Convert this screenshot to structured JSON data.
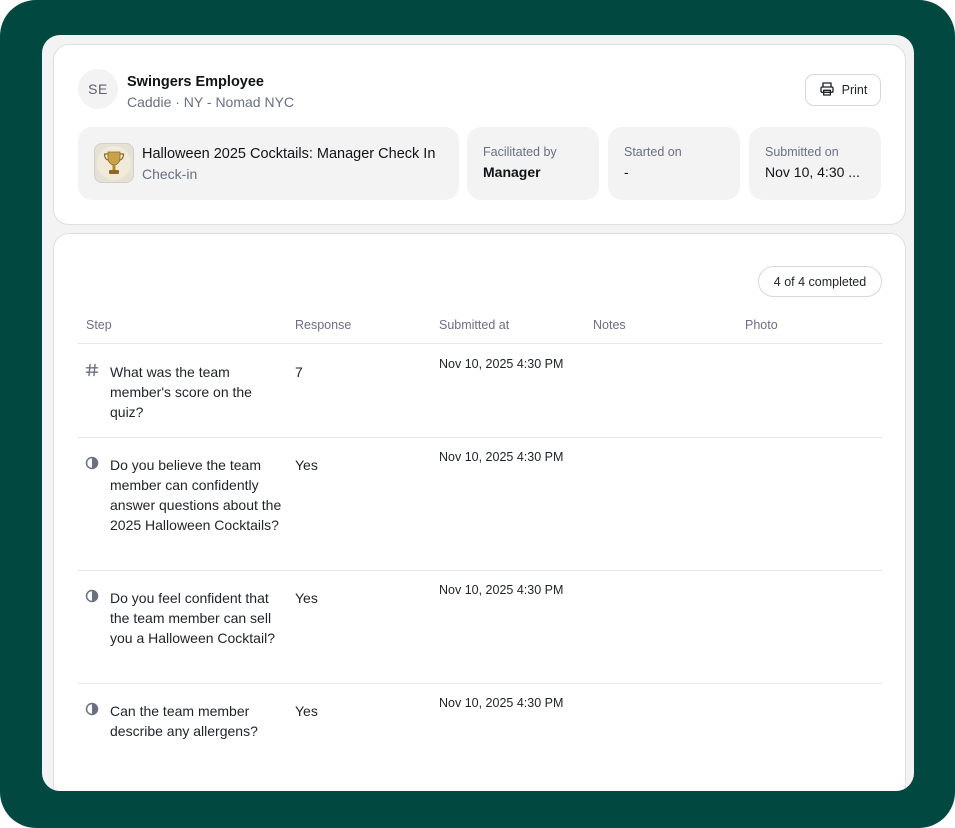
{
  "employee": {
    "initials": "SE",
    "name": "Swingers Employee",
    "subtitle": "Caddie · NY - Nomad NYC"
  },
  "actions": {
    "print_label": "Print"
  },
  "checkin": {
    "title": "Halloween 2025 Cocktails: Manager Check In",
    "type": "Check-in"
  },
  "meta": {
    "facilitated_label": "Facilitated by",
    "facilitated_value": "Manager",
    "started_label": "Started on",
    "started_value": "-",
    "submitted_label": "Submitted on",
    "submitted_value": "Nov 10, 4:30 ..."
  },
  "progress": {
    "label": "4 of 4 completed"
  },
  "table": {
    "headers": [
      "Step",
      "Response",
      "Submitted at",
      "Notes",
      "Photo"
    ],
    "rows": [
      {
        "icon": "hash-icon",
        "step": "What was the team member's score on the quiz?",
        "response": "7",
        "submitted_at": "Nov 10, 2025 4:30 PM"
      },
      {
        "icon": "half-circle-icon",
        "step": "Do you believe the team member can confidently answer questions about the 2025 Halloween Cocktails?",
        "response": "Yes",
        "submitted_at": "Nov 10, 2025 4:30 PM"
      },
      {
        "icon": "half-circle-icon",
        "step": "Do you feel confident that the team member can sell you a Halloween Cocktail?",
        "response": "Yes",
        "submitted_at": "Nov 10, 2025 4:30 PM"
      },
      {
        "icon": "half-circle-icon",
        "step": "Can the team member describe any allergens?",
        "response": "Yes",
        "submitted_at": "Nov 10, 2025 4:30 PM"
      }
    ]
  }
}
